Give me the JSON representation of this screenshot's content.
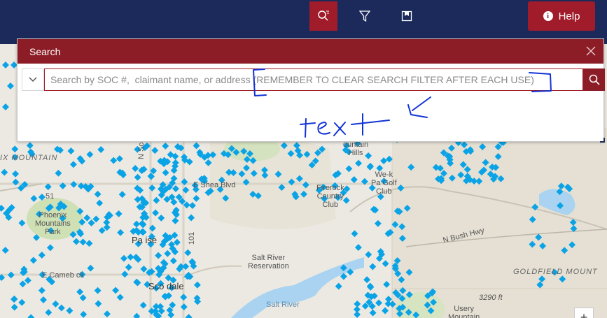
{
  "toolbar": {
    "tools": [
      {
        "name": "search-tool-button",
        "icon": "search-list-icon",
        "active": true
      },
      {
        "name": "filter-tool-button",
        "icon": "filter-icon",
        "active": false
      },
      {
        "name": "bookmark-tool-button",
        "icon": "bookmark-icon",
        "active": false
      }
    ],
    "help_label": "Help",
    "help_icon": "info-icon"
  },
  "search_panel": {
    "title": "Search",
    "placeholder": "Search by SOC #,  claimant name, or address (REMEMBER TO CLEAR SEARCH FILTER AFTER EACH USE)",
    "value": ""
  },
  "map": {
    "labels": [
      {
        "id": "ix-mountain",
        "text": "IX MOUNTAIN"
      },
      {
        "id": "mountain-hills",
        "text": "ountain\nHills"
      },
      {
        "id": "we-ko-pa",
        "text": "We-k\nPa Golf\nClub"
      },
      {
        "id": "firerock",
        "text": "Firerock\nCountry\nClub"
      },
      {
        "id": "shea",
        "text": "E Shea Blvd"
      },
      {
        "id": "scott",
        "text": "N Scott"
      },
      {
        "id": "phoenix-mtn",
        "text": "Phoenix\nMountains\nPark"
      },
      {
        "id": "salt-river",
        "text": "Salt River\nReservation"
      },
      {
        "id": "bush-hwy",
        "text": "N Bush Hwy"
      },
      {
        "id": "goldfield",
        "text": "GOLDFIELD MOUNT"
      },
      {
        "id": "elevation",
        "text": "3290 ft"
      },
      {
        "id": "paradise",
        "text": "Pa  ise"
      },
      {
        "id": "scottsdale",
        "text": "Sco  dale"
      },
      {
        "id": "camelback",
        "text": "E Cameb ck"
      },
      {
        "id": "usery",
        "text": "Usery\nMountain"
      },
      {
        "id": "salt-river-water",
        "text": "Salt River"
      },
      {
        "id": "hwy-51",
        "text": "51"
      },
      {
        "id": "hwy-101",
        "text": "101"
      }
    ],
    "marker_color": "#0aa3e6"
  },
  "annotation": {
    "handwritten": "text"
  },
  "colors": {
    "navbar": "#1b2a5b",
    "accent": "#a11c2a",
    "panel_header": "#8c1d26",
    "annotation_ink": "#1233d6"
  }
}
